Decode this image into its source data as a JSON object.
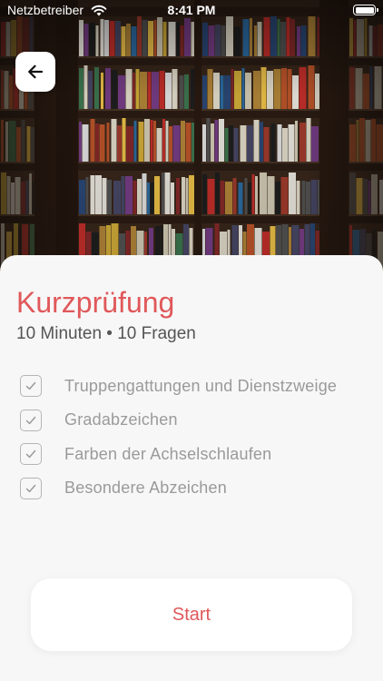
{
  "status_bar": {
    "carrier": "Netzbetreiber",
    "time": "8:41 PM",
    "icons": [
      "wifi-icon",
      "battery-icon"
    ]
  },
  "header": {
    "back_icon": "arrow-left-icon",
    "background": "bookshelf-photo"
  },
  "quiz": {
    "title": "Kurzprüfung",
    "subtitle": "10 Minuten • 10 Fragen",
    "topics": [
      {
        "label": "Truppengattungen und Dienstzweige",
        "checked": true
      },
      {
        "label": "Gradabzeichen",
        "checked": true
      },
      {
        "label": "Farben der Achselschlaufen",
        "checked": true
      },
      {
        "label": "Besondere Abzeichen",
        "checked": true
      }
    ]
  },
  "actions": {
    "start_label": "Start"
  },
  "colors": {
    "accent": "#e0585a",
    "background": "#f7f7f7",
    "checkbox_border": "#b5b5b5",
    "topic_text": "#9a9a9a"
  }
}
